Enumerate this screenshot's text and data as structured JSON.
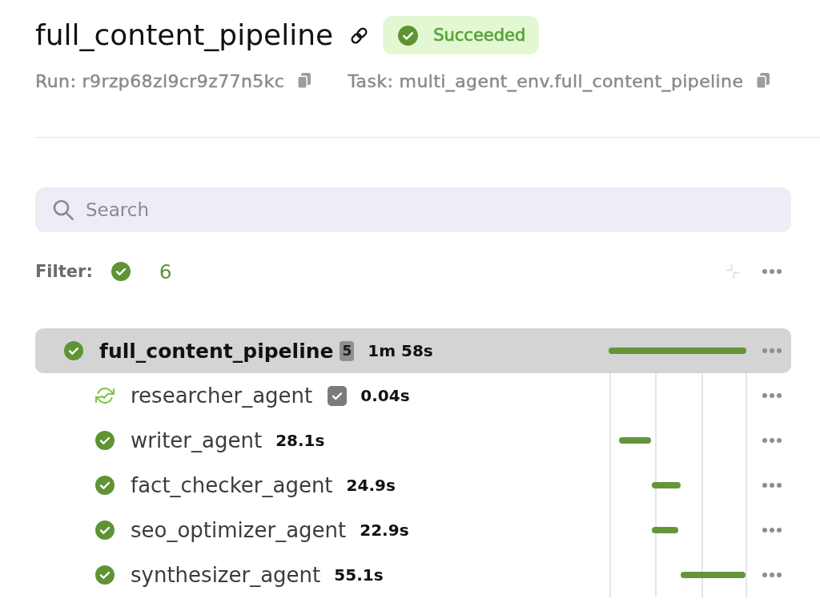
{
  "header": {
    "title": "full_content_pipeline",
    "status": {
      "kind": "succeeded",
      "label": "Succeeded"
    },
    "meta": [
      {
        "text": "Run: r9rzp68zl9cr9z77n5kc"
      },
      {
        "text": "Task: multi_agent_env.full_content_pipeline"
      }
    ]
  },
  "search": {
    "placeholder": "Search"
  },
  "filter": {
    "label": "Filter:",
    "chips": [
      {
        "kind": "succeeded",
        "count": "6"
      }
    ]
  },
  "tree": [
    {
      "name": "full_content_pipeline",
      "kind": "succeeded",
      "child_count": "5",
      "duration": "1m 58s",
      "selected": true,
      "children": [
        {
          "name": "researcher_agent",
          "kind": "cached",
          "check_badge": true,
          "duration": "0.04s",
          "selected": false
        },
        {
          "name": "writer_agent",
          "kind": "succeeded",
          "check_badge": false,
          "duration": "28.1s",
          "selected": false
        },
        {
          "name": "fact_checker_agent",
          "kind": "succeeded",
          "check_badge": false,
          "duration": "24.9s",
          "selected": false
        },
        {
          "name": "seo_optimizer_agent",
          "kind": "succeeded",
          "check_badge": false,
          "duration": "22.9s",
          "selected": false
        },
        {
          "name": "synthesizer_agent",
          "kind": "succeeded",
          "check_badge": false,
          "duration": "55.1s",
          "selected": false
        }
      ]
    }
  ]
}
